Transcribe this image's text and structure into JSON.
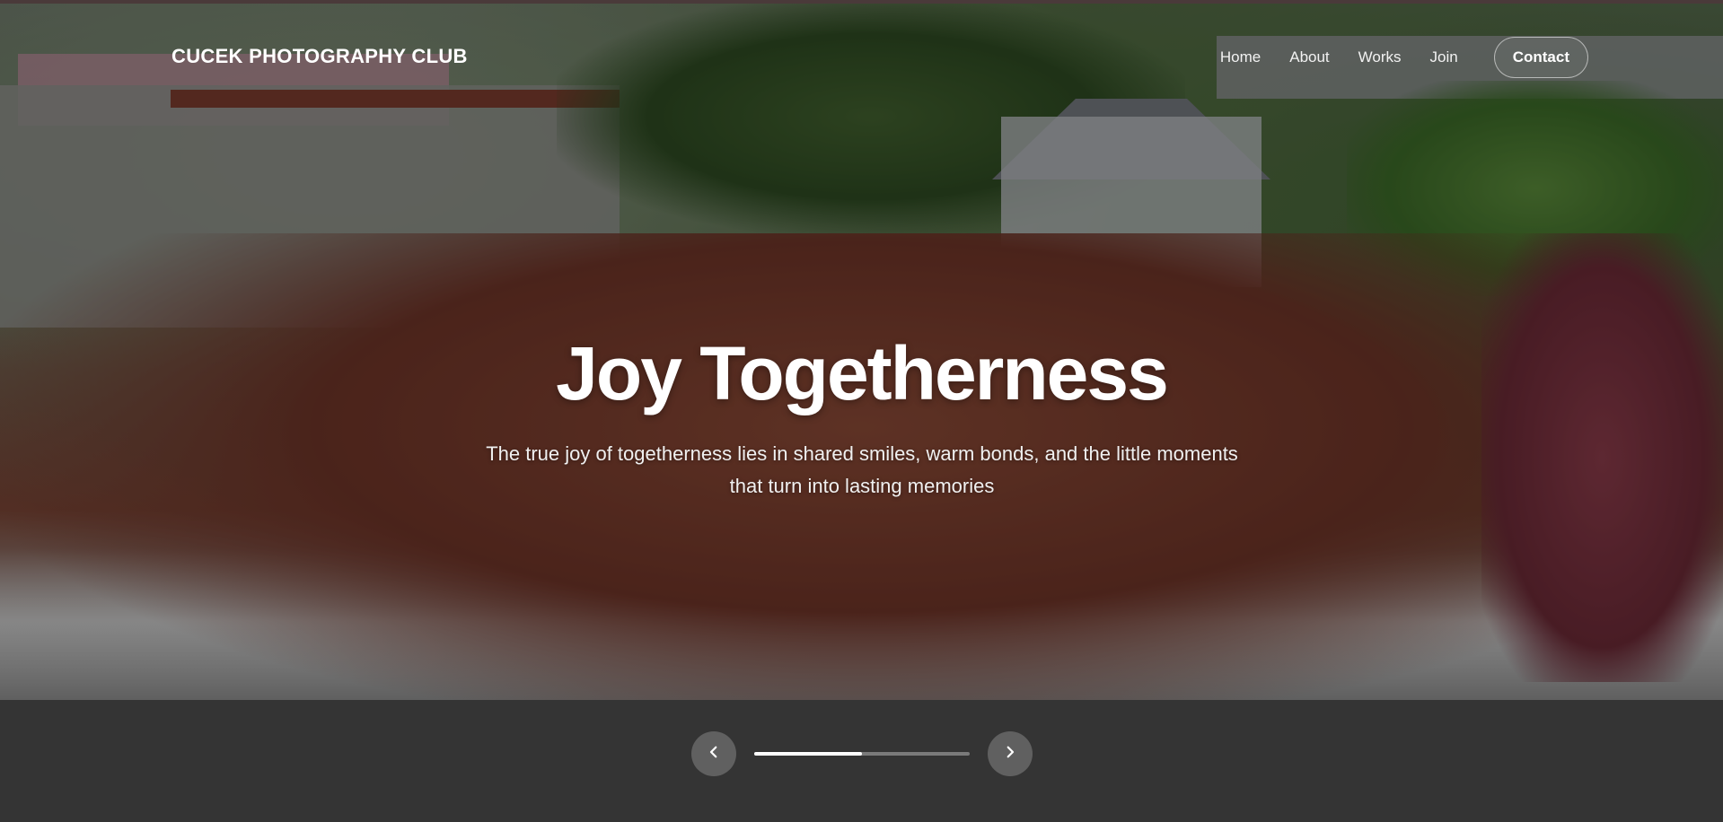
{
  "header": {
    "site_title": "CUCEK PHOTOGRAPHY CLUB",
    "nav": {
      "home": "Home",
      "about": "About",
      "works": "Works",
      "join": "Join",
      "contact": "Contact"
    }
  },
  "hero": {
    "headline": "Joy Togetherness",
    "subtext": "The true joy of togetherness lies in shared smiles, warm bonds, and the little moments that turn into lasting memories",
    "background_icon": "group-photo-image"
  },
  "slider": {
    "prev_icon": "chevron-left-icon",
    "next_icon": "chevron-right-icon",
    "progress": 0.5
  },
  "colors": {
    "text": "#ffffff",
    "overlay": "#000000"
  }
}
